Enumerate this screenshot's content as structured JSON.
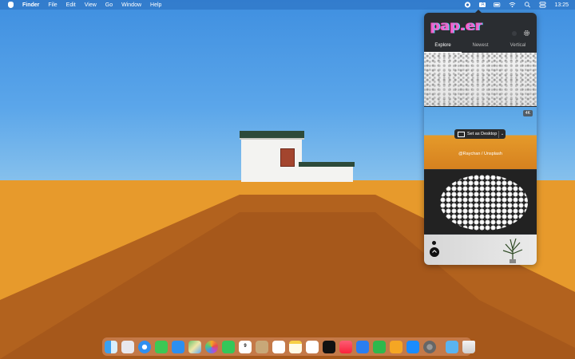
{
  "menubar": {
    "app_name": "Finder",
    "items": [
      "File",
      "Edit",
      "View",
      "Go",
      "Window",
      "Help"
    ],
    "clock": "13:25",
    "input_source": "A"
  },
  "paper": {
    "logo": "pap.er",
    "tabs": [
      "Explore",
      "Newest",
      "Vertical"
    ],
    "active_tab": "Explore",
    "badge": "4K",
    "set_button_label": "Set as Desktop",
    "credit": "@Raychan / Unsplash"
  },
  "dock": {
    "calendar_day": "9",
    "apps": [
      "Finder",
      "Launchpad",
      "Safari",
      "Messages",
      "Mail",
      "Maps",
      "Photos",
      "FaceTime",
      "Calendar",
      "Contacts",
      "Reminders",
      "Notes",
      "Freeform",
      "Apple TV",
      "Music",
      "Keynote",
      "Numbers",
      "Pages",
      "App Store",
      "System Settings"
    ],
    "others": [
      "Downloads",
      "Trash"
    ]
  },
  "colors": {
    "sky": "#4a98e4",
    "sand": "#e79a2c",
    "popover": "#2a2d31",
    "menubar": "#2f6fbf"
  }
}
